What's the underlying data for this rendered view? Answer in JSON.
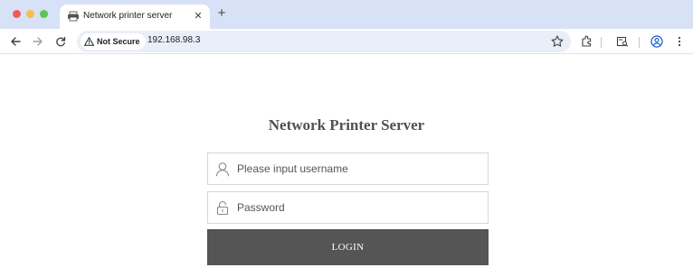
{
  "browser": {
    "tab": {
      "title": "Network printer server",
      "favicon": "printer-icon"
    },
    "new_tab_label": "+",
    "close_label": "✕",
    "address_bar": {
      "security_label": "Not Secure",
      "url": "192.168.98.3"
    },
    "colors": {
      "tabstrip": "#d7e2f7",
      "omnibox": "#e9eef8"
    }
  },
  "login_page": {
    "title": "Network Printer Server",
    "username": {
      "placeholder": "Please input username",
      "value": "",
      "icon": "user-icon"
    },
    "password": {
      "placeholder": "Password",
      "value": "",
      "icon": "lock-icon"
    },
    "login_button_label": "LOGIN",
    "colors": {
      "button_bg": "#555555",
      "title_text": "#505050"
    }
  }
}
